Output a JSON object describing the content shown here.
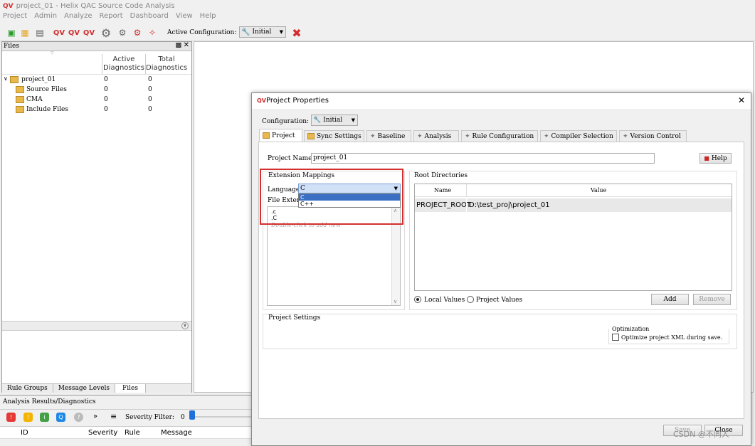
{
  "app": {
    "title": "project_01 - Helix QAC Source Code Analysis",
    "menu": [
      "Project",
      "Admin",
      "Analyze",
      "Report",
      "Dashboard",
      "View",
      "Help"
    ],
    "toolbar": {
      "active_config_label": "Active Configuration:",
      "active_config_value": "Initial"
    }
  },
  "files_panel": {
    "title": "Files",
    "col_active": [
      "Active",
      "Diagnostics"
    ],
    "col_total": [
      "Total",
      "Diagnostics"
    ],
    "rows": [
      {
        "name": "project_01",
        "active": "0",
        "total": "0"
      },
      {
        "name": "Source Files",
        "active": "0",
        "total": "0"
      },
      {
        "name": "CMA",
        "active": "0",
        "total": "0"
      },
      {
        "name": "Include Files",
        "active": "0",
        "total": "0"
      }
    ],
    "bottom_tabs": [
      "Rule Groups",
      "Message Levels",
      "Files"
    ]
  },
  "results_panel": {
    "title": "Analysis Results/Diagnostics",
    "more": "»",
    "severity_label": "Severity Filter:",
    "severity_value": "0",
    "columns": [
      "ID",
      "Severity",
      "Rule",
      "Message"
    ]
  },
  "dialog": {
    "title": "Project Properties",
    "configuration_label": "Configuration:",
    "configuration_value": "Initial",
    "tabs": [
      "Project",
      "Sync Settings",
      "Baseline",
      "Analysis",
      "Rule Configuration",
      "Compiler Selection",
      "Version Control"
    ],
    "project_name_label": "Project Name:",
    "project_name_value": "project_01",
    "help_button": "Help",
    "ext_group": "Extension Mappings",
    "language_label": "Language:",
    "language_value": "C",
    "language_options": [
      "C",
      "C++"
    ],
    "file_ext_label": "File Exten",
    "extensions": [
      ".c",
      ".C"
    ],
    "ext_hint": "Double-click to add new",
    "root_group": "Root Directories",
    "root_columns": [
      "Name",
      "Value"
    ],
    "root_rows": [
      {
        "name": "PROJECT_ROOT",
        "value": "D:\\test_proj\\project_01"
      }
    ],
    "local_values": "Local Values",
    "project_values": "Project Values",
    "add_button": "Add",
    "remove_button": "Remove",
    "settings_group": "Project Settings",
    "optimization_label": "Optimization",
    "optimize_checkbox": "Optimize project XML during save.",
    "save_button": "Save",
    "close_button": "Close"
  },
  "watermark": "CSDN @不同人",
  "colors": {
    "accent": "#d32f2f",
    "selection": "#3a6fc4",
    "folder": "#e8b84a"
  }
}
